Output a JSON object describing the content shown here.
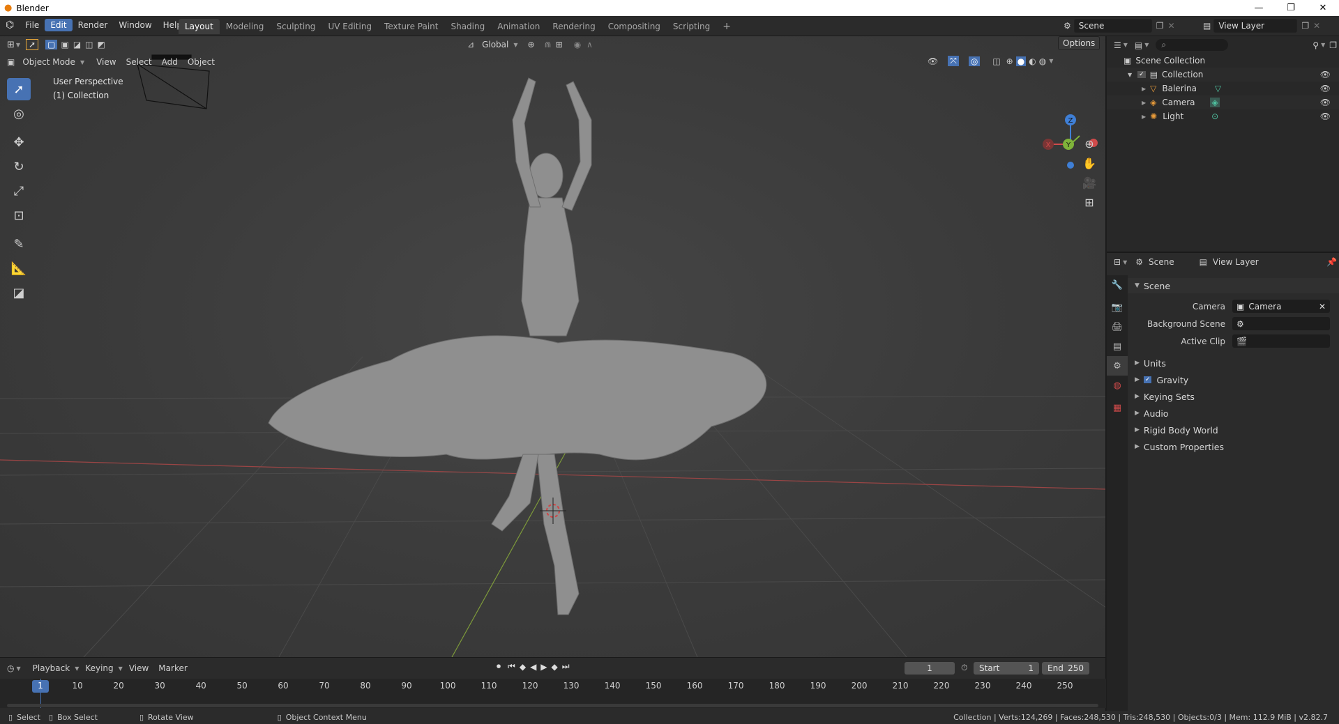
{
  "window": {
    "title": "Blender",
    "controls": [
      "—",
      "❐",
      "✕"
    ]
  },
  "menu": {
    "items": [
      "File",
      "Edit",
      "Render",
      "Window",
      "Help"
    ],
    "active": "Edit"
  },
  "workspaces": {
    "tabs": [
      "Layout",
      "Modeling",
      "Sculpting",
      "UV Editing",
      "Texture Paint",
      "Shading",
      "Animation",
      "Rendering",
      "Compositing",
      "Scripting"
    ],
    "active": "Layout",
    "add": "+"
  },
  "scene_selector": {
    "label": "Scene"
  },
  "viewlayer_selector": {
    "label": "View Layer"
  },
  "viewport": {
    "mode": "Object Mode",
    "menus": [
      "View",
      "Select",
      "Add",
      "Object"
    ],
    "transform_orientation": "Global",
    "options_label": "Options",
    "overlay_line1": "User Perspective",
    "overlay_line2": "(1) Collection",
    "gizmo": {
      "x": "X",
      "y": "Y",
      "z": "Z"
    }
  },
  "timeline": {
    "menus": [
      "Playback",
      "Keying",
      "View",
      "Marker"
    ],
    "current_frame": "1",
    "start_label": "Start",
    "start_value": "1",
    "end_label": "End",
    "end_value": "250",
    "ticks": [
      "1",
      "10",
      "20",
      "30",
      "40",
      "50",
      "60",
      "70",
      "80",
      "90",
      "100",
      "110",
      "120",
      "130",
      "140",
      "150",
      "160",
      "170",
      "180",
      "190",
      "200",
      "210",
      "220",
      "230",
      "240",
      "250"
    ]
  },
  "outliner": {
    "root": "Scene Collection",
    "collection": "Collection",
    "items": [
      {
        "name": "Balerina",
        "icon": "mesh-icon",
        "color": "#e89b3a"
      },
      {
        "name": "Camera",
        "icon": "camera-icon",
        "color": "#e89b3a"
      },
      {
        "name": "Light",
        "icon": "light-icon",
        "color": "#e89b3a"
      }
    ]
  },
  "properties": {
    "header_scene": "Scene",
    "header_viewlayer": "View Layer",
    "panel_title": "Scene",
    "camera_label": "Camera",
    "camera_value": "Camera",
    "background_scene_label": "Background Scene",
    "active_clip_label": "Active Clip",
    "subpanels": [
      "Units",
      "Gravity",
      "Keying Sets",
      "Audio",
      "Rigid Body World",
      "Custom Properties"
    ]
  },
  "statusbar": {
    "select": "Select",
    "box_select": "Box Select",
    "rotate_view": "Rotate View",
    "context_menu": "Object Context Menu",
    "stats": "Collection | Verts:124,269 | Faces:248,530 | Tris:248,530 | Objects:0/3 | Mem: 112.9 MiB | v2.82.7"
  },
  "colors": {
    "accent": "#4772b3",
    "x_axis": "#d14b4b",
    "y_axis": "#7fb33a",
    "z_axis": "#3f7fd6"
  }
}
